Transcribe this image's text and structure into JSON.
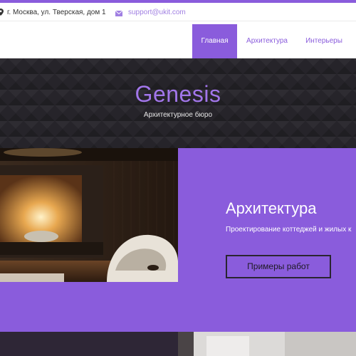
{
  "topbar": {
    "address": "г. Москва, ул. Тверская, дом 1",
    "email": "support@ukit.com",
    "address_icon": "map-pin-icon",
    "email_icon": "envelope-icon"
  },
  "nav": {
    "items": [
      {
        "label": "Главная",
        "active": true
      },
      {
        "label": "Архитектура",
        "active": false
      },
      {
        "label": "Интерьеры",
        "active": false
      }
    ]
  },
  "hero": {
    "title": "Genesis",
    "subtitle": "Архитектурное бюро"
  },
  "feature": {
    "title": "Архитектура",
    "text": "Проектирование коттеджей и жилых к",
    "button_label": "Примеры работ"
  },
  "colors": {
    "accent": "#8a5cdc",
    "hero_bg": "#26242a",
    "title_color": "#a276ea"
  }
}
